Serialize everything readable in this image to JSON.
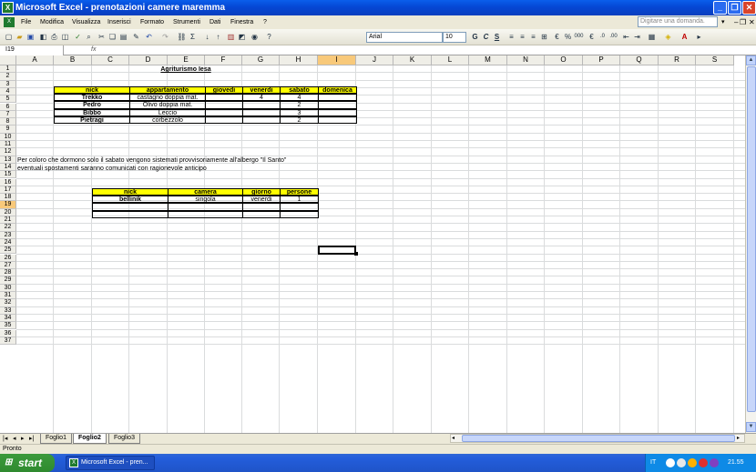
{
  "window": {
    "title": "Microsoft Excel - prenotazioni camere maremma"
  },
  "menu": [
    "File",
    "Modifica",
    "Visualizza",
    "Inserisci",
    "Formato",
    "Strumenti",
    "Dati",
    "Finestra",
    "?"
  ],
  "help_placeholder": "Digitare una domanda.",
  "toolbar": {
    "font": "Arial",
    "size": "10",
    "zoom": "Σ"
  },
  "formula": {
    "name_box": "I19",
    "fx": "fx",
    "content": ""
  },
  "columns": [
    "A",
    "B",
    "C",
    "D",
    "E",
    "F",
    "G",
    "H",
    "I",
    "J",
    "K",
    "L",
    "M",
    "N",
    "O",
    "P",
    "Q",
    "R",
    "S"
  ],
  "selected_column": "I",
  "selected_row": "19",
  "rows": [
    "1",
    "2",
    "3",
    "4",
    "5",
    "6",
    "7",
    "8",
    "9",
    "10",
    "11",
    "12",
    "13",
    "14",
    "15",
    "16",
    "17",
    "18",
    "19",
    "20",
    "21",
    "22",
    "23",
    "24",
    "25",
    "26",
    "27",
    "28",
    "29",
    "30",
    "31",
    "32",
    "33",
    "34",
    "35",
    "36",
    "37"
  ],
  "sheet": {
    "title": "Agriturismo Iesa",
    "table1": {
      "headers": [
        "nick",
        "appartamento",
        "giovedi",
        "venerdi",
        "sabato",
        "domenica"
      ],
      "rows": [
        {
          "nick": "Trekko",
          "appartamento": "castagno doppia mat.",
          "giovedi": "",
          "venerdi": "4",
          "sabato": "4",
          "domenica": ""
        },
        {
          "nick": "Pedro",
          "appartamento": "Olivo doppia mat.",
          "giovedi": "",
          "venerdi": "",
          "sabato": "2",
          "domenica": ""
        },
        {
          "nick": "Bibbo",
          "appartamento": "Leccio",
          "giovedi": "",
          "venerdi": "",
          "sabato": "3",
          "domenica": ""
        },
        {
          "nick": "Pietragi",
          "appartamento": "corbezzolo",
          "giovedi": "",
          "venerdi": "",
          "sabato": "2",
          "domenica": ""
        }
      ]
    },
    "note1": "Per coloro che dormono solo il sabato vengono sistemati provvisoriamente all'albergo \"Il Santo\"",
    "note2": "eventuali spostamenti saranno comunicati con ragionevole anticipo",
    "table2": {
      "headers": [
        "nick",
        "camera",
        "giorno",
        "persone"
      ],
      "rows": [
        {
          "nick": "bellinik",
          "camera": "singola",
          "giorno": "venerdi",
          "persone": "1"
        }
      ]
    }
  },
  "tabs": [
    "Foglio1",
    "Foglio2",
    "Foglio3"
  ],
  "active_tab": "Foglio2",
  "status": "Pronto",
  "taskbar": {
    "start": "start",
    "item": "Microsoft Excel - pren...",
    "lang": "IT",
    "clock": "21.55"
  }
}
